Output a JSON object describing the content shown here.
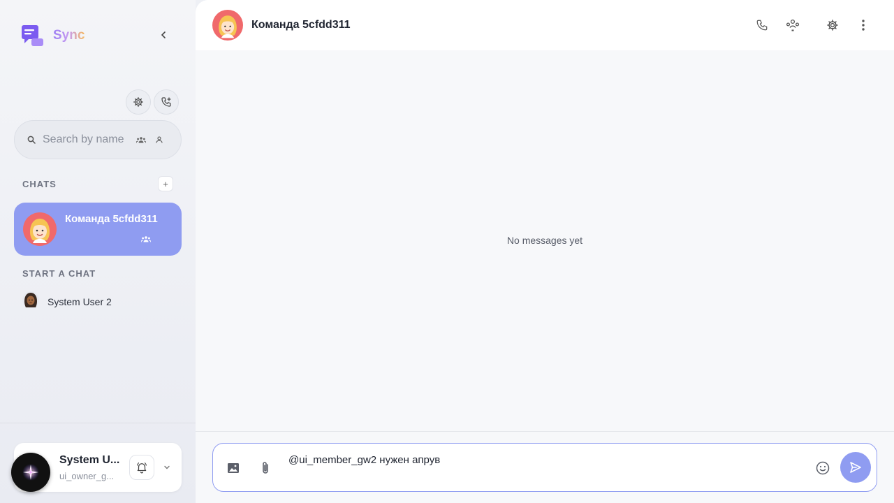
{
  "app": {
    "name": "Sync"
  },
  "sidebar": {
    "search_placeholder": "Search by name",
    "chats_title": "CHATS",
    "add_chat_label": "+",
    "start_chat_title": "START A CHAT",
    "active_chat": {
      "name": "Команда 5cfdd311",
      "avatar": "girl-avatar"
    },
    "start_users": [
      {
        "name": "System User 2",
        "avatar": "user-avatar"
      }
    ],
    "profile": {
      "name": "System U...",
      "username": "ui_owner_g..."
    }
  },
  "header": {
    "title": "Команда 5cfdd311"
  },
  "main": {
    "empty_text": "No messages yet"
  },
  "composer": {
    "value": "@ui_member_gw2 нужен апрув"
  },
  "colors": {
    "accent": "#8f9cf1",
    "brand_purple": "#7b5bf0"
  }
}
